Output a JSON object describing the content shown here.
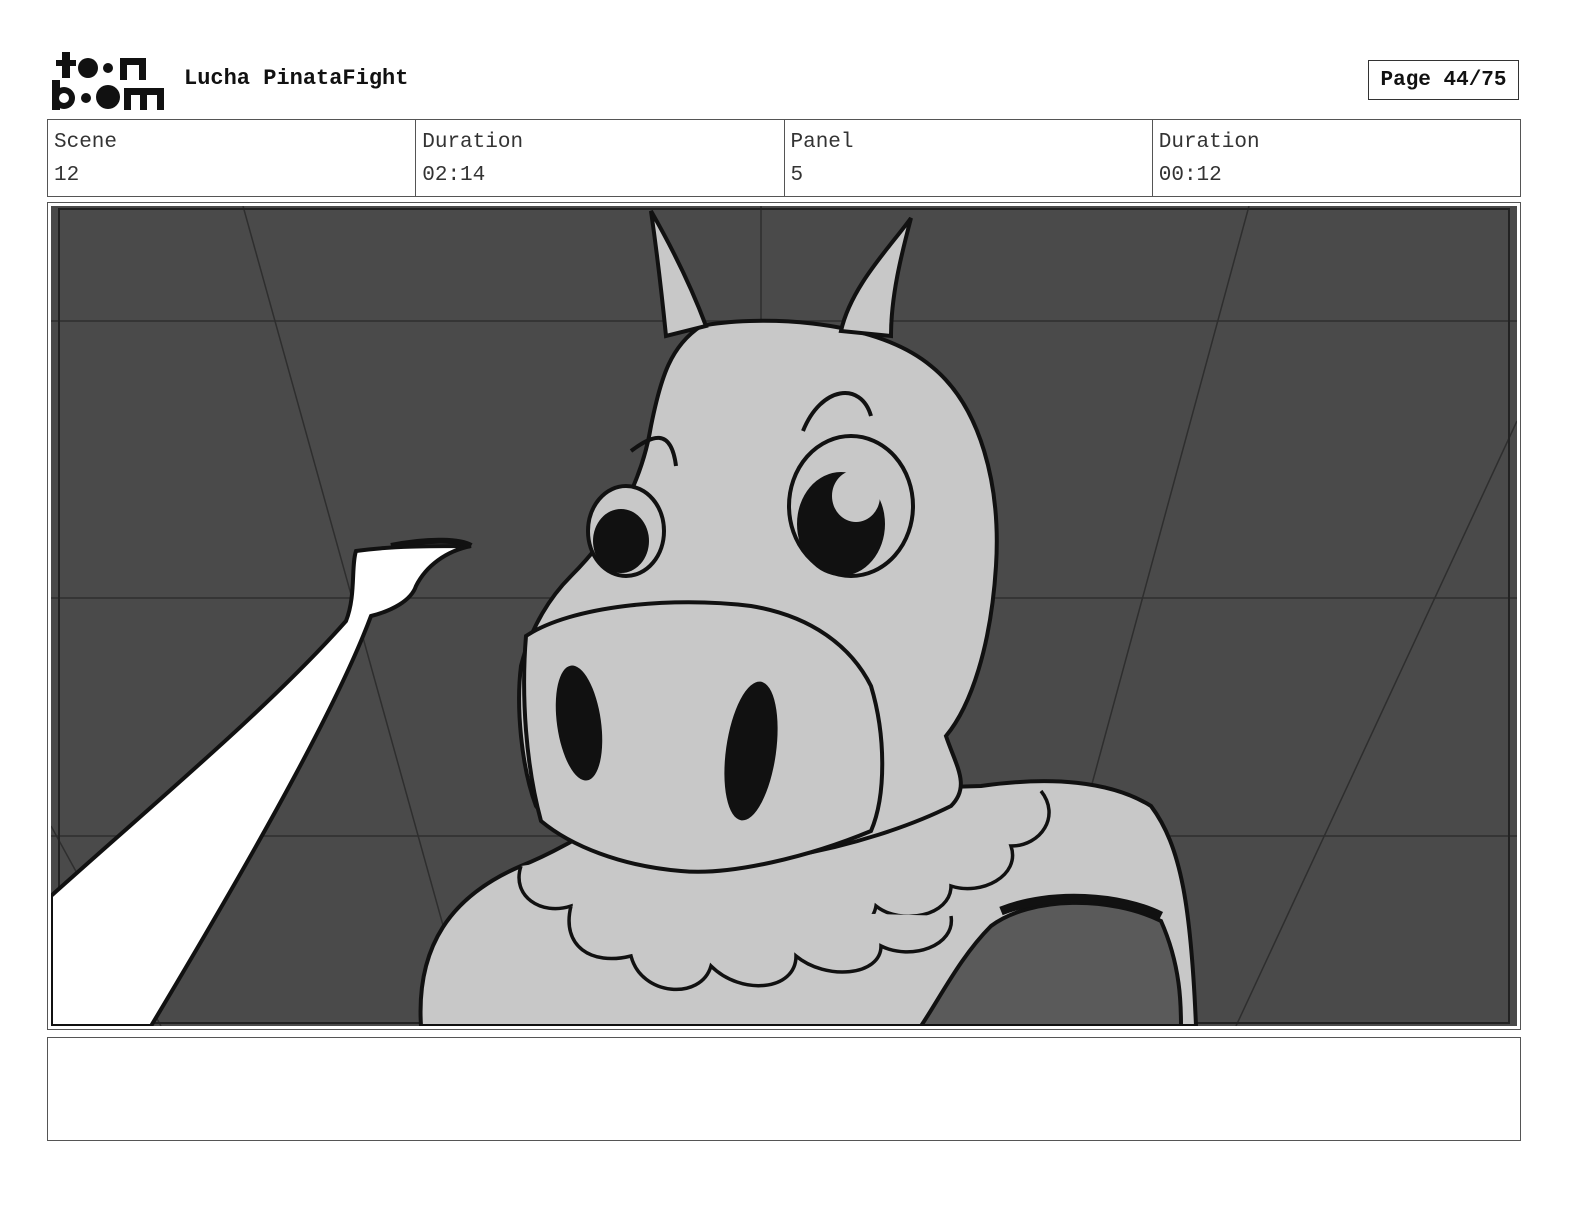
{
  "header": {
    "logo_top": "to n",
    "logo_bottom": "b m",
    "project_title": "Lucha PinataFight",
    "page_label": "Page 44/75"
  },
  "info": {
    "scene": {
      "label": "Scene",
      "value": "12"
    },
    "scene_duration": {
      "label": "Duration",
      "value": "02:14"
    },
    "panel": {
      "label": "Panel",
      "value": "5"
    },
    "panel_duration": {
      "label": "Duration",
      "value": "00:12"
    }
  },
  "panel_image": {
    "subject": "pinata-horse-character",
    "background_color": "#4a4a4a",
    "character_fill": "#c8c8c8",
    "arm_fill": "#ffffff",
    "line_color": "#111111"
  },
  "notes": {
    "text": ""
  }
}
